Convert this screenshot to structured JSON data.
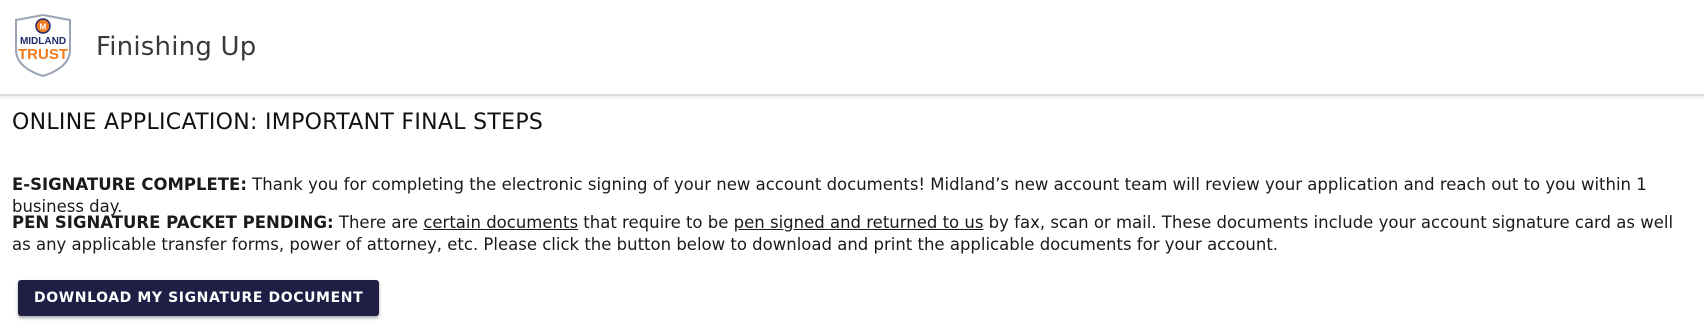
{
  "header": {
    "logo": {
      "line1": "MIDLAND",
      "line2": "TRUST",
      "brand_orange": "#f07a1e",
      "brand_navy": "#1f2a6b"
    },
    "title": "Finishing Up"
  },
  "main": {
    "heading": "ONLINE APPLICATION: IMPORTANT FINAL STEPS",
    "esig": {
      "label": "E-SIGNATURE COMPLETE:",
      "text": " Thank you for completing the electronic signing of your new account documents! Midland’s new account team will review your application and reach out to you within 1 business day."
    },
    "pen": {
      "label": "PEN SIGNATURE PACKET PENDING:",
      "text_a": " There are ",
      "link_a": "certain documents",
      "text_b": " that require to be ",
      "link_b": "pen signed and returned to us",
      "text_c": " by fax, scan or mail. These documents include your account signature card as well as any applicable transfer forms, power of attorney, etc. Please click the button below to download and print the applicable documents for your account."
    },
    "download_button": "DOWNLOAD MY SIGNATURE DOCUMENT"
  },
  "colors": {
    "button_bg": "#1f1f45",
    "divider": "#d9d9d9"
  }
}
